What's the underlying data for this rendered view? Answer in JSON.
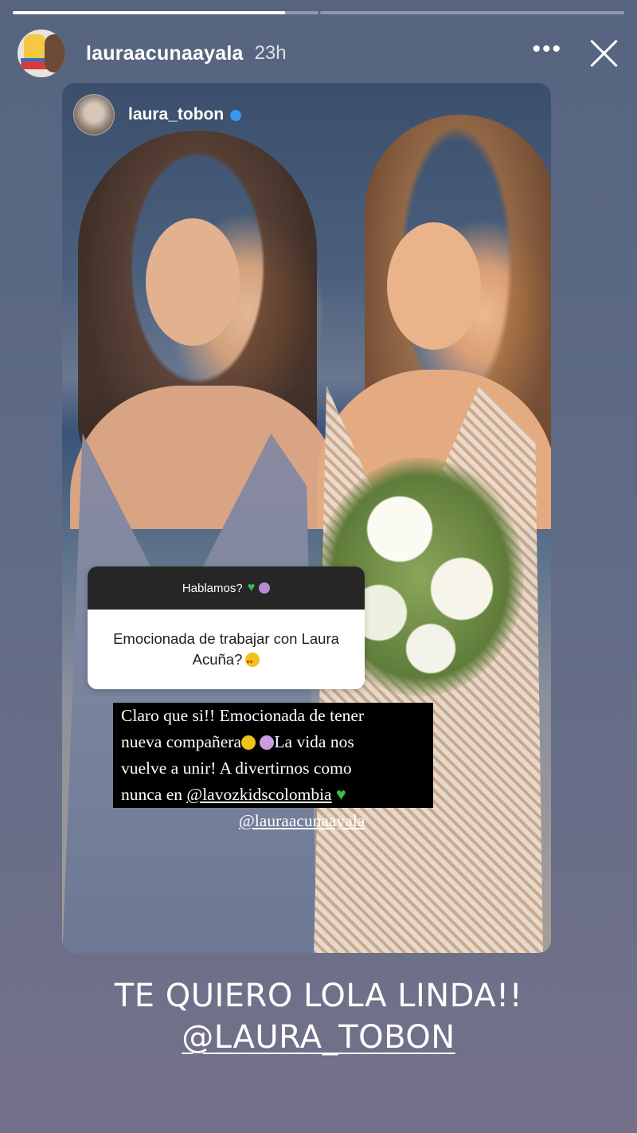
{
  "story": {
    "progress": [
      {
        "fill": 0.89
      },
      {
        "fill": 0.0
      }
    ],
    "header": {
      "username": "lauraacunaayala",
      "time": "23h",
      "more_label": "•••"
    },
    "post": {
      "username": "laura_tobon",
      "question": {
        "prompt": "Hablamos?",
        "text": "Emocionada de trabajar con Laura Acuña?"
      },
      "answer": {
        "line1": "Claro que si!! Emocionada de tener",
        "line2a": "nueva compañera",
        "line2b": "La vida nos",
        "line3": "vuelve a unir! A divertirnos como",
        "line4a": "nunca en",
        "mention1": "@lavozkidscolombia",
        "mention2": "@lauraacunaayala"
      }
    },
    "caption": {
      "line1": "TE QUIERO LOLA LINDA!!",
      "mention": "@LAURA_TOBON"
    }
  },
  "colors": {
    "verified": "#3897f0",
    "heart_green": "#37c14a"
  }
}
